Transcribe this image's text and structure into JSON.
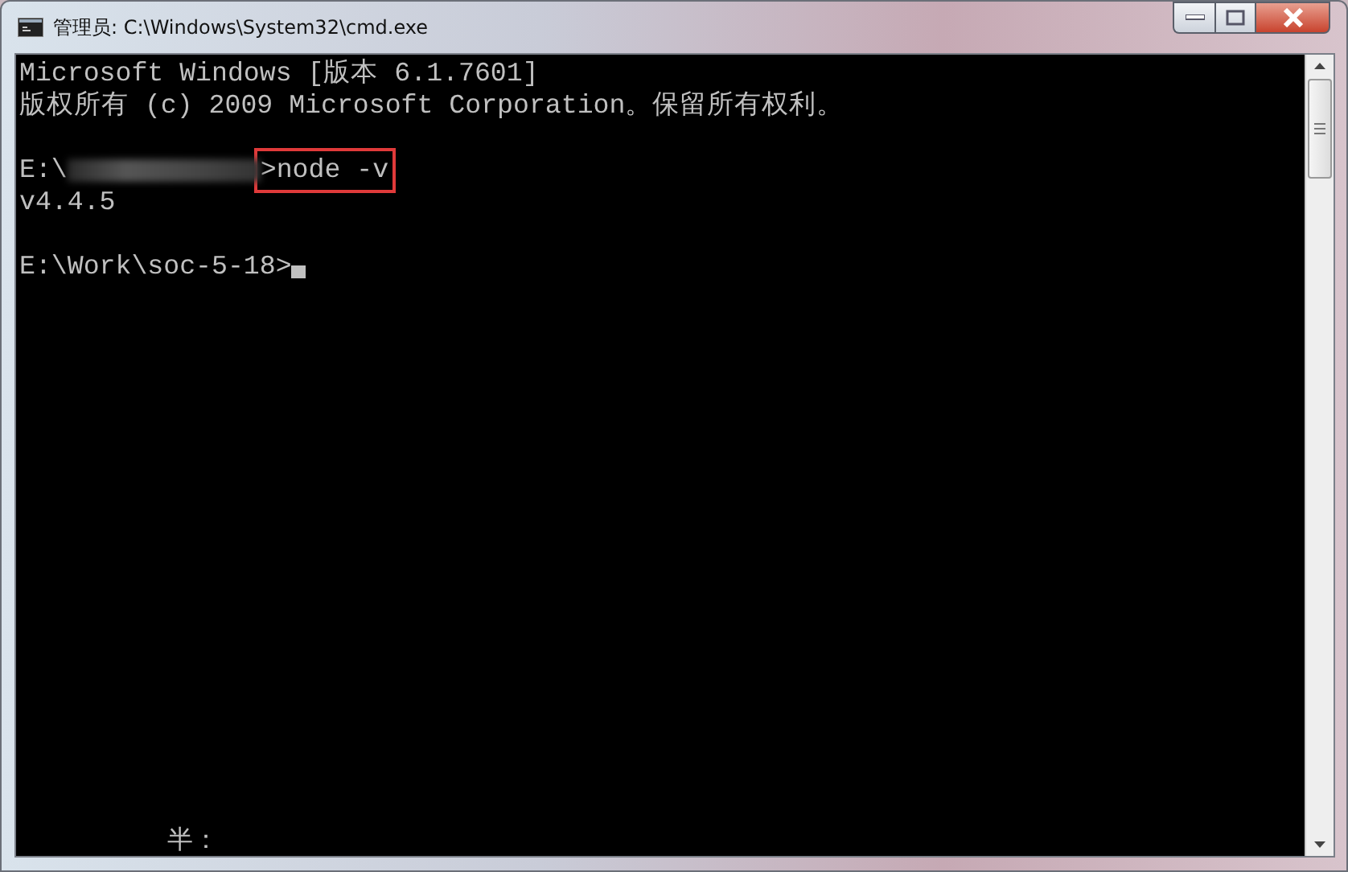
{
  "window": {
    "title": "管理员: C:\\Windows\\System32\\cmd.exe"
  },
  "console": {
    "lines": [
      {
        "kind": "text",
        "text": "Microsoft Windows [版本 6.1.7601]"
      },
      {
        "kind": "text",
        "text": "版权所有 (c) 2009 Microsoft Corporation。保留所有权利。"
      },
      {
        "kind": "blank"
      },
      {
        "kind": "command",
        "prompt": "E:\\",
        "redacted": true,
        "command": ">node -v",
        "highlighted": true
      },
      {
        "kind": "text",
        "text": "v4.4.5"
      },
      {
        "kind": "blank"
      },
      {
        "kind": "prompt",
        "text": "E:\\Work\\soc-5-18>",
        "cursor": true
      }
    ],
    "ime_status": "半："
  }
}
